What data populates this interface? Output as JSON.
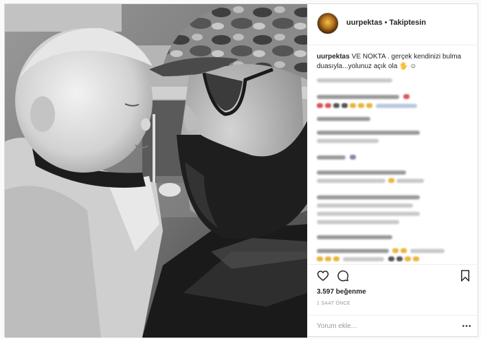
{
  "post": {
    "username": "uurpektas",
    "separator": "•",
    "follow_status": "Takiptesin",
    "caption_user": "uurpektas",
    "caption_text": "VE NOKTA . gerçek kendinizi bulma duasıyla...yolunuz açık ola 🖐 ☺",
    "likes": "3.597 beğenme",
    "time_ago": "1 SAAT ÖNCE",
    "comment_placeholder": "Yorum ekle..."
  },
  "icons": {
    "like": "heart-icon",
    "comment": "speech-bubble-icon",
    "save": "bookmark-icon",
    "more": "more-options-icon"
  },
  "colors": {
    "text": "#262626",
    "muted": "#999999",
    "border": "#dbdbdb"
  }
}
